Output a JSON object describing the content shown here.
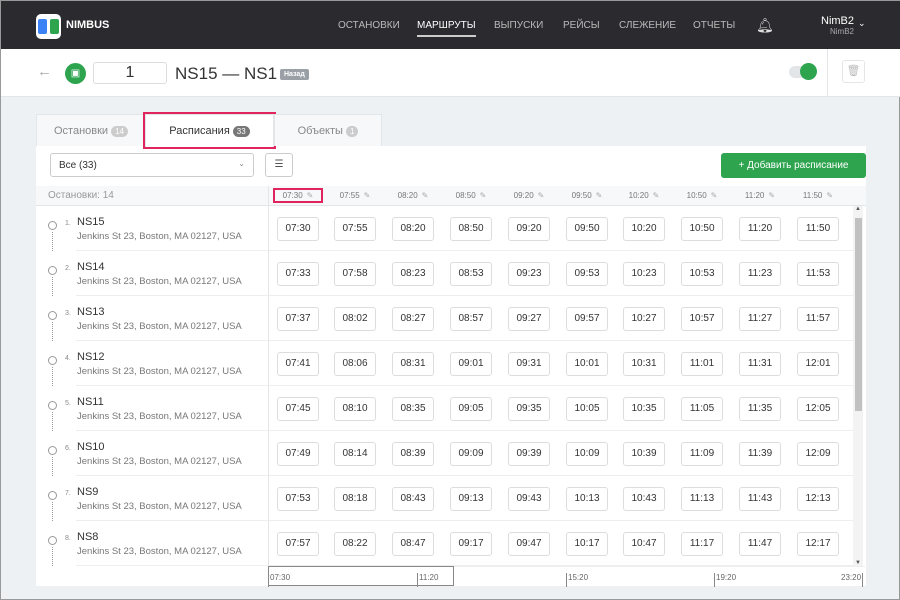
{
  "brand": "NIMBUS",
  "nav": [
    "ОСТАНОВКИ",
    "МАРШРУТЫ",
    "ВЫПУСКИ",
    "РЕЙСЫ",
    "СЛЕЖЕНИЕ",
    "ОТЧЕТЫ"
  ],
  "nav_active": 1,
  "user": {
    "name": "NimB2",
    "sub": "NimB2"
  },
  "route": {
    "number": "1",
    "title": "NS15 — NS1",
    "direction": "Назад",
    "active": true
  },
  "tabs": [
    {
      "label": "Остановки",
      "count": "14"
    },
    {
      "label": "Расписания",
      "count": "33"
    },
    {
      "label": "Объекты",
      "count": "1"
    }
  ],
  "filter": {
    "value": "Все (33)"
  },
  "add_label": "+ Добавить расписание",
  "stops_label": "Остановки: 14",
  "departures": [
    "07:30",
    "07:55",
    "08:20",
    "08:50",
    "09:20",
    "09:50",
    "10:20",
    "10:50",
    "11:20",
    "11:50"
  ],
  "stops": [
    {
      "idx": "1.",
      "name": "NS15",
      "addr": "Jenkins St 23, Boston, MA 02127, USA",
      "times": [
        "07:30",
        "07:55",
        "08:20",
        "08:50",
        "09:20",
        "09:50",
        "10:20",
        "10:50",
        "11:20",
        "11:50"
      ]
    },
    {
      "idx": "2.",
      "name": "NS14",
      "addr": "Jenkins St 23, Boston, MA 02127, USA",
      "times": [
        "07:33",
        "07:58",
        "08:23",
        "08:53",
        "09:23",
        "09:53",
        "10:23",
        "10:53",
        "11:23",
        "11:53"
      ]
    },
    {
      "idx": "3.",
      "name": "NS13",
      "addr": "Jenkins St 23, Boston, MA 02127, USA",
      "times": [
        "07:37",
        "08:02",
        "08:27",
        "08:57",
        "09:27",
        "09:57",
        "10:27",
        "10:57",
        "11:27",
        "11:57"
      ]
    },
    {
      "idx": "4.",
      "name": "NS12",
      "addr": "Jenkins St 23, Boston, MA 02127, USA",
      "times": [
        "07:41",
        "08:06",
        "08:31",
        "09:01",
        "09:31",
        "10:01",
        "10:31",
        "11:01",
        "11:31",
        "12:01"
      ]
    },
    {
      "idx": "5.",
      "name": "NS11",
      "addr": "Jenkins St 23, Boston, MA 02127, USA",
      "times": [
        "07:45",
        "08:10",
        "08:35",
        "09:05",
        "09:35",
        "10:05",
        "10:35",
        "11:05",
        "11:35",
        "12:05"
      ]
    },
    {
      "idx": "6.",
      "name": "NS10",
      "addr": "Jenkins St 23, Boston, MA 02127, USA",
      "times": [
        "07:49",
        "08:14",
        "08:39",
        "09:09",
        "09:39",
        "10:09",
        "10:39",
        "11:09",
        "11:39",
        "12:09"
      ]
    },
    {
      "idx": "7.",
      "name": "NS9",
      "addr": "Jenkins St 23, Boston, MA 02127, USA",
      "times": [
        "07:53",
        "08:18",
        "08:43",
        "09:13",
        "09:43",
        "10:13",
        "10:43",
        "11:13",
        "11:43",
        "12:13"
      ]
    },
    {
      "idx": "8.",
      "name": "NS8",
      "addr": "Jenkins St 23, Boston, MA 02127, USA",
      "times": [
        "07:57",
        "08:22",
        "08:47",
        "09:17",
        "09:47",
        "10:17",
        "10:47",
        "11:17",
        "11:47",
        "12:17"
      ]
    }
  ],
  "timeline": [
    "07:30",
    "11:20",
    "15:20",
    "19:20",
    "23:20"
  ]
}
